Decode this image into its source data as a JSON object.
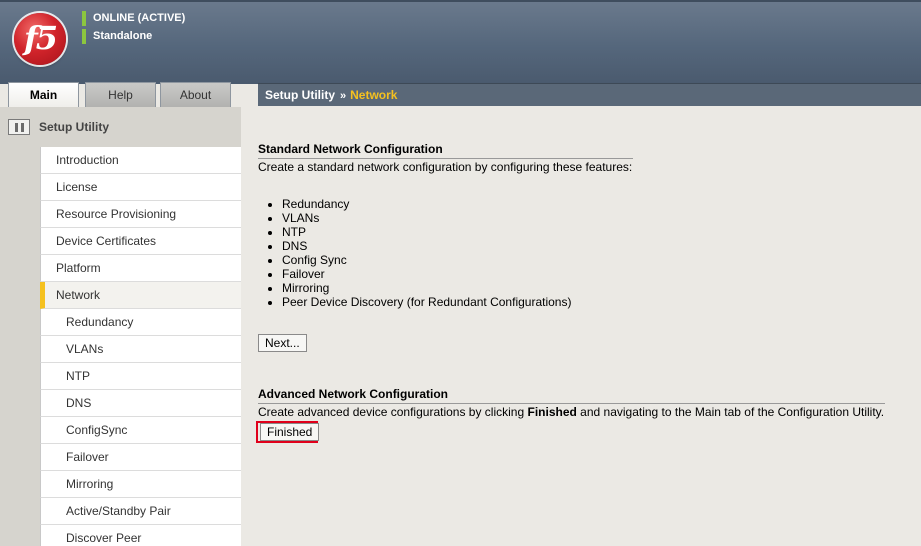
{
  "banner": {
    "logo": "f5",
    "status_online": "ONLINE (ACTIVE)",
    "status_mode": "Standalone",
    "status_color": "#8cc63f"
  },
  "tabs": [
    {
      "label": "Main",
      "active": true
    },
    {
      "label": "Help",
      "active": false
    },
    {
      "label": "About",
      "active": false
    }
  ],
  "page_header": {
    "section": "Setup Utility",
    "separator": "»",
    "current": "Network",
    "current_color": "#f5c11f"
  },
  "sidebar": {
    "title": "Setup Utility",
    "icon": "setup-utility-icon",
    "items": [
      {
        "label": "Introduction",
        "level": 0
      },
      {
        "label": "License",
        "level": 0
      },
      {
        "label": "Resource Provisioning",
        "level": 0
      },
      {
        "label": "Device Certificates",
        "level": 0
      },
      {
        "label": "Platform",
        "level": 0
      },
      {
        "label": "Network",
        "level": 0,
        "active": true
      },
      {
        "label": "Redundancy",
        "level": 1
      },
      {
        "label": "VLANs",
        "level": 1
      },
      {
        "label": "NTP",
        "level": 1
      },
      {
        "label": "DNS",
        "level": 1
      },
      {
        "label": "ConfigSync",
        "level": 1
      },
      {
        "label": "Failover",
        "level": 1
      },
      {
        "label": "Mirroring",
        "level": 1
      },
      {
        "label": "Active/Standby Pair",
        "level": 1
      },
      {
        "label": "Discover Peer",
        "level": 1
      }
    ]
  },
  "standard": {
    "title": "Standard Network Configuration",
    "description": "Create a standard network configuration by configuring these features:",
    "features": [
      "Redundancy",
      "VLANs",
      "NTP",
      "DNS",
      "Config Sync",
      "Failover",
      "Mirroring",
      "Peer Device Discovery (for Redundant Configurations)"
    ],
    "next_label": "Next..."
  },
  "advanced": {
    "title": "Advanced Network Configuration",
    "description_pre": "Create advanced device configurations by clicking ",
    "description_bold": "Finished",
    "description_post": " and navigating to the Main tab of the Configuration Utility.",
    "finished_label": "Finished",
    "highlight_color": "#e0001b"
  }
}
